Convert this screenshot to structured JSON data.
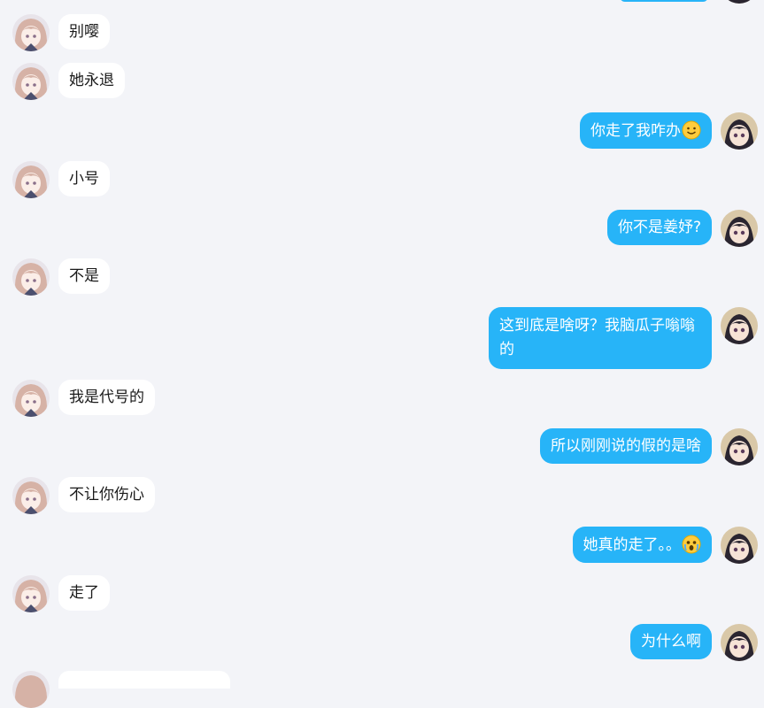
{
  "messages": [
    {
      "side": "left",
      "text": "别嘤"
    },
    {
      "side": "left",
      "text": "她永退"
    },
    {
      "side": "right",
      "text": "你走了我咋办",
      "emoji": "smile-emoji"
    },
    {
      "side": "left",
      "text": "小号"
    },
    {
      "side": "right",
      "text": "你不是姜妤?"
    },
    {
      "side": "left",
      "text": "不是"
    },
    {
      "side": "right",
      "text": "这到底是啥呀？我脑瓜子嗡嗡的"
    },
    {
      "side": "left",
      "text": "我是代号的"
    },
    {
      "side": "right",
      "text": "所以刚刚说的假的是啥"
    },
    {
      "side": "left",
      "text": "不让你伤心"
    },
    {
      "side": "right",
      "text": "她真的走了。。",
      "emoji": "crying-emoji"
    },
    {
      "side": "left",
      "text": "走了"
    },
    {
      "side": "right",
      "text": "为什么啊"
    }
  ],
  "colors": {
    "background": "#f3f4f8",
    "outgoing_bubble": "#27b4f8",
    "incoming_bubble": "#ffffff"
  }
}
